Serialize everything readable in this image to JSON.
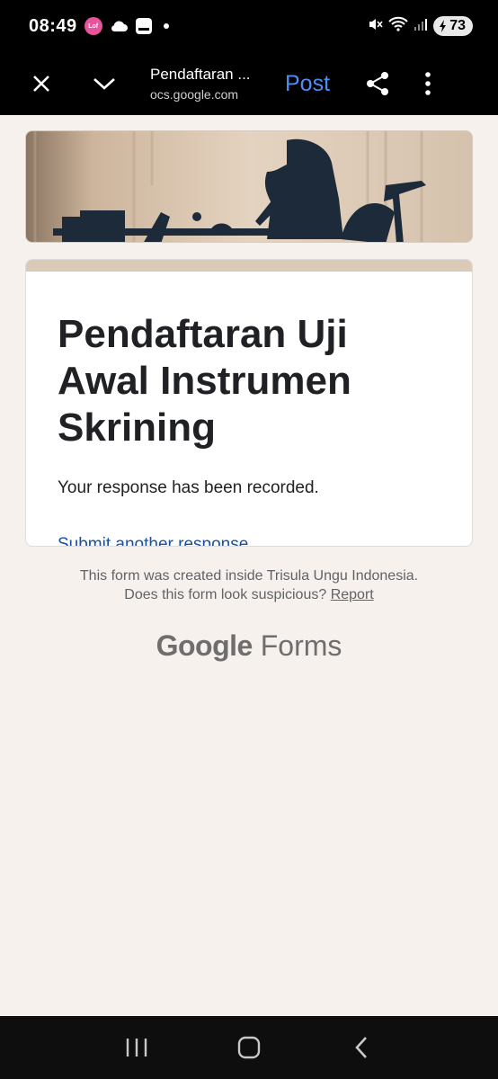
{
  "status_bar": {
    "time": "08:49",
    "app_badge_text": "Lof",
    "battery_level": "73"
  },
  "app_bar": {
    "page_title": "Pendaftaran ...",
    "url": "ocs.google.com",
    "post_label": "Post"
  },
  "form": {
    "title": "Pendaftaran Uji Awal Instrumen Skrining",
    "confirmation": "Your response has been recorded.",
    "submit_another_label": "Submit another response"
  },
  "footer": {
    "created_inside": "This form was created inside Trisula Ungu Indonesia.",
    "suspicious_question": "Does this form look suspicious?",
    "report_label": "Report",
    "logo_google": "Google",
    "logo_forms": "Forms"
  },
  "colors": {
    "accent_link": "#1a4fa3",
    "post_blue": "#4c8df6",
    "card_accent": "#dccab8",
    "background": "#f6f1ec"
  },
  "icons": {
    "close": "close-icon",
    "chevron": "chevron-down-icon",
    "share": "share-icon",
    "more": "more-vert-icon",
    "nav_recents": "recents-icon",
    "nav_home": "home-icon",
    "nav_back": "back-icon"
  }
}
